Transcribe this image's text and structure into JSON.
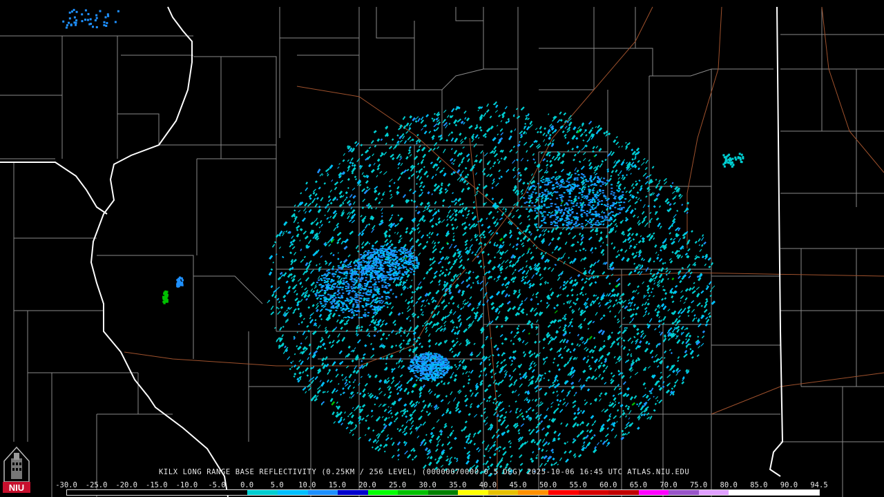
{
  "product": {
    "caption": "KILX LONG RANGE BASE REFLECTIVITY (0.25KM / 256 LEVEL) (00000070000 0.5 DEG) 2025-10-06 16:45 UTC  ATLAS.NIU.EDU"
  },
  "logo": {
    "text": "NIU",
    "color": "#c8102e"
  },
  "scale": {
    "labels": [
      "-30.0",
      "-25.0",
      "-20.0",
      "-15.0",
      "-10.0",
      "-5.0",
      "0.0",
      "5.0",
      "10.0",
      "15.0",
      "20.0",
      "25.0",
      "30.0",
      "35.0",
      "40.0",
      "45.0",
      "50.0",
      "55.0",
      "60.0",
      "65.0",
      "70.0",
      "75.0",
      "80.0",
      "85.0",
      "90.0",
      "94.5"
    ],
    "colors": [
      "#000000",
      "#000000",
      "#000000",
      "#000000",
      "#000000",
      "#000000",
      "#00ced1",
      "#00bfff",
      "#1e90ff",
      "#0000cd",
      "#00ff00",
      "#00c000",
      "#008000",
      "#ffff00",
      "#e7c000",
      "#ff9000",
      "#ff0000",
      "#d60000",
      "#c00000",
      "#ff00ff",
      "#9955c9",
      "#e0a0ff",
      "#ffffff",
      "#ffffff",
      "#ffffff"
    ]
  },
  "map_colors": {
    "county_lines": "#8a8a8a",
    "state_lines": "#ffffff",
    "highways": "#a0522d",
    "radar_site": "#000000"
  }
}
